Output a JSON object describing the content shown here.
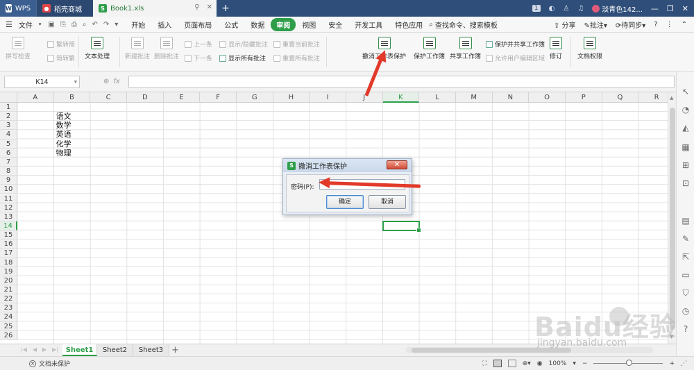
{
  "titlebar": {
    "tabs": [
      {
        "label": "WPS",
        "icon": "wps-logo-icon"
      },
      {
        "label": "稻壳商城",
        "icon": "store-icon"
      },
      {
        "label": "Book1.xls",
        "icon": "spreadsheet-icon"
      }
    ],
    "badge": "1",
    "user": "淡青色142..."
  },
  "menubar": {
    "file_label": "文件",
    "items": [
      "开始",
      "插入",
      "页面布局",
      "公式",
      "数据",
      "审阅",
      "视图",
      "安全",
      "开发工具",
      "特色应用"
    ],
    "active": "审阅",
    "search_label": "查找命令、搜索模板",
    "share_label": "分享",
    "comment_label": "批注",
    "sync_label": "待同步",
    "help_label": "?"
  },
  "ribbon": {
    "spellcheck": "拼写检查",
    "to_traditional": "繁转简",
    "to_simplified": "简转繁",
    "text_processing": "文本处理",
    "new_comment": "新建批注",
    "delete_comment": "删除批注",
    "prev": "上一条",
    "next": "下一条",
    "show_hide_comment": "显示/隐藏批注",
    "show_all_comments": "显示所有批注",
    "reset_current_comment": "重置当前批注",
    "reset_all_comments": "重置所有批注",
    "unprotect_sheet": "撤消工作表保护",
    "protect_workbook": "保护工作簿",
    "share_workbook": "共享工作簿",
    "protect_share_workbook": "保护并共享工作簿",
    "allow_edit_ranges": "允许用户编辑区域",
    "track_changes": "修订",
    "doc_permission": "文档权限"
  },
  "formula_bar": {
    "name_box": "K14",
    "fx_label": "fx",
    "value": ""
  },
  "grid": {
    "columns": [
      "A",
      "B",
      "C",
      "D",
      "E",
      "F",
      "G",
      "H",
      "I",
      "J",
      "K",
      "L",
      "M",
      "N",
      "O",
      "P",
      "Q",
      "R"
    ],
    "rows": [
      "1",
      "2",
      "3",
      "4",
      "5",
      "6",
      "7",
      "8",
      "9",
      "10",
      "11",
      "12",
      "13",
      "14",
      "15",
      "16",
      "17",
      "18",
      "19",
      "20",
      "21",
      "22",
      "23",
      "24",
      "25",
      "26"
    ],
    "selected_column": "K",
    "selected_row": "14",
    "b_column_values": [
      "语文",
      "数学",
      "英语",
      "化学",
      "物理"
    ]
  },
  "dialog": {
    "title": "撤消工作表保护",
    "password_label": "密码(P):",
    "password_value": "",
    "ok_label": "确定",
    "cancel_label": "取消"
  },
  "sheets": {
    "tabs": [
      "Sheet1",
      "Sheet2",
      "Sheet3"
    ],
    "active": "Sheet1",
    "add_label": "+"
  },
  "statusbar": {
    "protection_text": "文档未保护",
    "zoom": "100%",
    "zoom_minus": "−",
    "zoom_plus": "+"
  },
  "watermark": {
    "brand": "Baidu经验",
    "url": "jingyan.baidu.com"
  },
  "colors": {
    "accent_green": "#2e9e4a",
    "title_blue": "#2f4f7a",
    "arrow_red": "#e23a2a"
  }
}
